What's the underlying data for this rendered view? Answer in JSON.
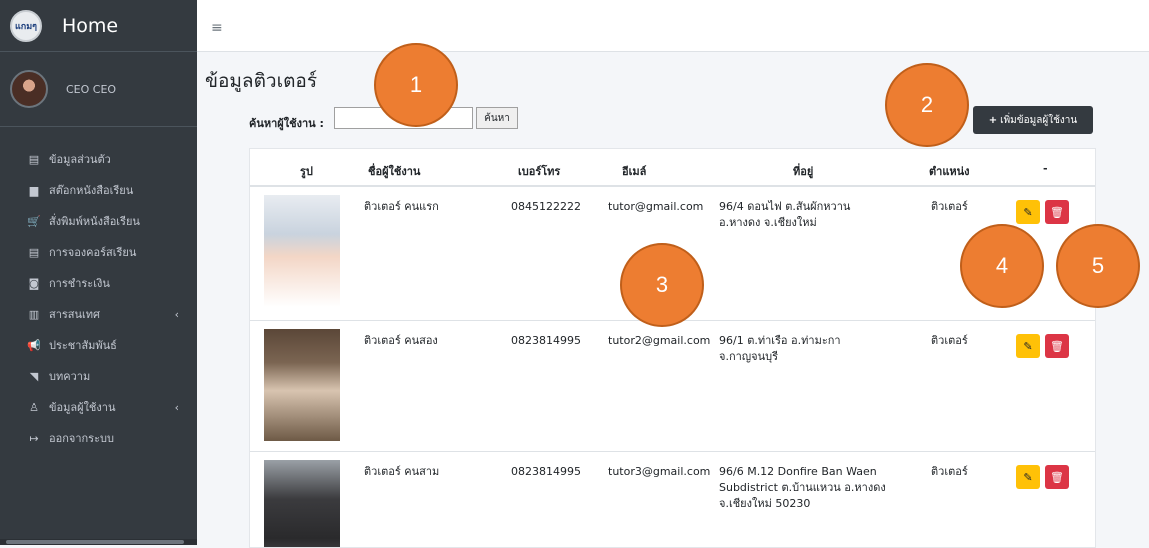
{
  "sidebar": {
    "brand": "Home",
    "brand_logo": "แกมๆ",
    "user_name": "CEO CEO",
    "items": [
      {
        "label": "ข้อมูลส่วนตัว",
        "icon": "▤"
      },
      {
        "label": "สต๊อกหนังสือเรียน",
        "icon": "▆"
      },
      {
        "label": "สั่งพิมพ์หนังสือเรียน",
        "icon": "🛒"
      },
      {
        "label": "การจองคอร์สเรียน",
        "icon": "▤"
      },
      {
        "label": "การชำระเงิน",
        "icon": "◙"
      },
      {
        "label": "สารสนเทศ",
        "icon": "▥",
        "chevron": "‹"
      },
      {
        "label": "ประชาสัมพันธ์",
        "icon": "📢"
      },
      {
        "label": "บทความ",
        "icon": "◥"
      },
      {
        "label": "ข้อมูลผู้ใช้งาน",
        "icon": "♙",
        "chevron": "‹"
      },
      {
        "label": "ออกจากระบบ",
        "icon": "↦"
      }
    ]
  },
  "topbar": {
    "menu_icon": "≡"
  },
  "page": {
    "title": "ข้อมูลติวเตอร์",
    "search_label": "ค้นหาผู้ใช้งาน :",
    "search_value": "",
    "search_button": "ค้นหา",
    "add_button": "เพิ่มข้อมูลผู้ใช้งาน",
    "add_icon": "+"
  },
  "table": {
    "headers": [
      "รูป",
      "ชื่อผู้ใช้งาน",
      "เบอร์โทร",
      "อีเมล์",
      "ที่อยู่",
      "ตำแหน่ง",
      "-"
    ],
    "rows": [
      {
        "name": "ติวเตอร์ คนแรก",
        "phone": "0845122222",
        "email": "tutor@gmail.com",
        "address": "96/4 ดอนไฟ ต.สันผักหวาน อ.หางดง จ.เชียงใหม่",
        "position": "ติวเตอร์"
      },
      {
        "name": "ติวเตอร์ คนสอง",
        "phone": "0823814995",
        "email": "tutor2@gmail.com",
        "address": "96/1 ต.ท่าเรือ อ.ท่ามะกา จ.กาญจนบุรี",
        "position": "ติวเตอร์"
      },
      {
        "name": "ติวเตอร์ คนสาม",
        "phone": "0823814995",
        "email": "tutor3@gmail.com",
        "address": "96/6 M.12 Donfire Ban Waen Subdistrict ต.บ้านแหวน อ.หางดง จ.เชียงใหม่ 50230",
        "position": "ติวเตอร์"
      }
    ],
    "edit_icon": "✎",
    "delete_icon": "🗑"
  },
  "callouts": [
    "1",
    "2",
    "3",
    "4",
    "5"
  ]
}
